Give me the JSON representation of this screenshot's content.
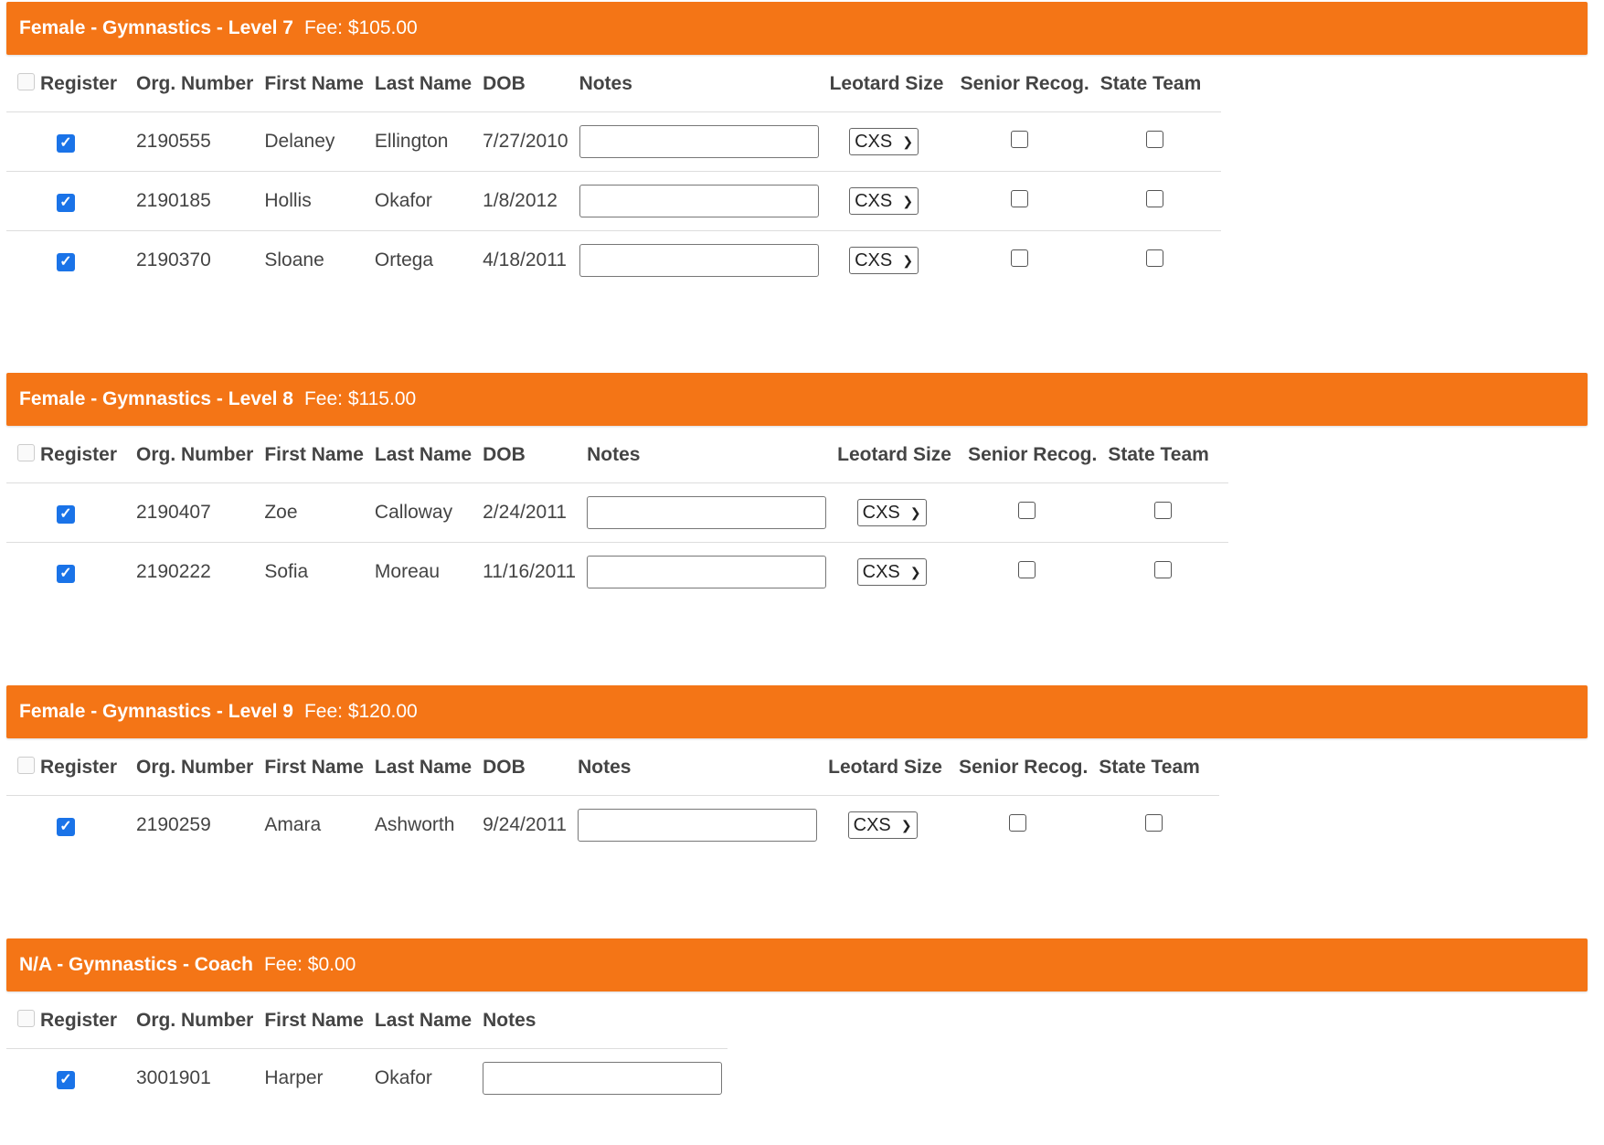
{
  "columns": {
    "register": "Register",
    "org": "Org. Number",
    "first": "First Name",
    "last": "Last Name",
    "dob": "DOB",
    "notes": "Notes",
    "leotard": "Leotard Size",
    "senior": "Senior Recog.",
    "state": "State Team"
  },
  "check_icon": "check-icon",
  "accent_color": "#f47516",
  "checkbox_color": "#1a73e8",
  "sections": [
    {
      "title": "Female - Gymnastics - Level 7",
      "fee": "Fee: $105.00",
      "rows": [
        {
          "org": "2190555",
          "first": "Delaney",
          "last": "Ellington",
          "dob": "7/27/2010",
          "leotard": "CXS",
          "registered": true,
          "senior": false,
          "state": false
        },
        {
          "org": "2190185",
          "first": "Hollis",
          "last": "Okafor",
          "dob": "1/8/2012",
          "leotard": "CXS",
          "registered": true,
          "senior": false,
          "state": false
        },
        {
          "org": "2190370",
          "first": "Sloane",
          "last": "Ortega",
          "dob": "4/18/2011",
          "leotard": "CXS",
          "registered": true,
          "senior": false,
          "state": false
        }
      ]
    },
    {
      "title": "Female - Gymnastics - Level 8",
      "fee": "Fee: $115.00",
      "rows": [
        {
          "org": "2190407",
          "first": "Zoe",
          "last": "Calloway",
          "dob": "2/24/2011",
          "leotard": "CXS",
          "registered": true,
          "senior": false,
          "state": false
        },
        {
          "org": "2190222",
          "first": "Sofia",
          "last": "Moreau",
          "dob": "11/16/2011",
          "leotard": "CXS",
          "registered": true,
          "senior": false,
          "state": false
        }
      ]
    },
    {
      "title": "Female - Gymnastics - Level 9",
      "fee": "Fee: $120.00",
      "rows": [
        {
          "org": "2190259",
          "first": "Amara",
          "last": "Ashworth",
          "dob": "9/24/2011",
          "leotard": "CXS",
          "registered": true,
          "senior": false,
          "state": false
        }
      ]
    },
    {
      "title": "N/A - Gymnastics - Coach",
      "fee": "Fee: $0.00",
      "rows": [
        {
          "org": "3001901",
          "first": "Harper",
          "last": "Okafor",
          "registered": true
        }
      ]
    }
  ]
}
